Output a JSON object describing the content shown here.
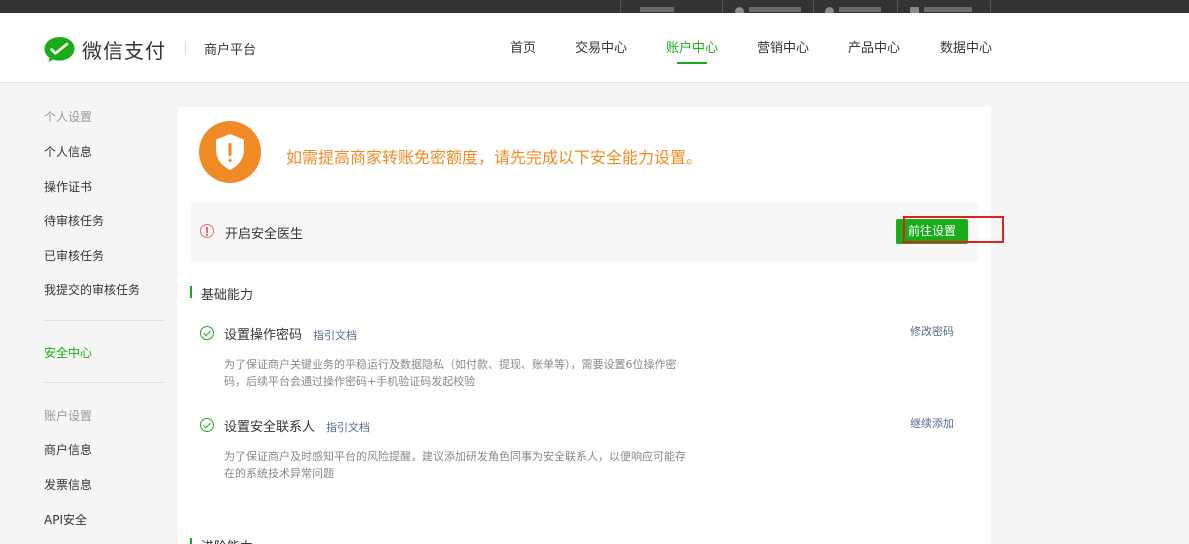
{
  "header": {
    "logo_text": "微信支付",
    "platform": "商户平台",
    "nav": [
      "首页",
      "交易中心",
      "账户中心",
      "营销中心",
      "产品中心",
      "数据中心"
    ],
    "active_nav": "账户中心"
  },
  "sidebar": {
    "group1_title": "个人设置",
    "group1_items": [
      "个人信息",
      "操作证书",
      "待审核任务",
      "已审核任务",
      "我提交的审核任务"
    ],
    "security_center": "安全中心",
    "group2_title": "账户设置",
    "group2_items": [
      "商户信息",
      "发票信息",
      "API安全"
    ]
  },
  "main": {
    "banner_text": "如需提高商家转账免密额度，请先完成以下安全能力设置。",
    "doctor": {
      "label": "开启安全医生",
      "button": "前往设置"
    },
    "basic_section_title": "基础能力",
    "items": [
      {
        "title": "设置操作密码",
        "doc_link": "指引文档",
        "action": "修改密码",
        "desc_line1": "为了保证商户关键业务的平稳运行及数据隐私（如付款、提现、账单等），需要设置6位操作密",
        "desc_line2": "码，后续平台会通过操作密码+手机验证码发起校验"
      },
      {
        "title": "设置安全联系人",
        "doc_link": "指引文档",
        "action": "继续添加",
        "desc_line1": "为了保证商户及时感知平台的风险提醒，建议添加研发角色同事为安全联系人，以便响应可能存",
        "desc_line2": "在的系统技术异常问题"
      }
    ],
    "advanced_section_title": "进阶能力"
  },
  "colors": {
    "brand_green": "#1aad19",
    "warning_orange": "#f08a24",
    "link_blue": "#576b95",
    "highlight_red": "#e02020"
  },
  "icons": [
    "wechat-pay-logo-icon",
    "shield-warning-icon",
    "alert-circle-icon",
    "check-circle-icon"
  ]
}
